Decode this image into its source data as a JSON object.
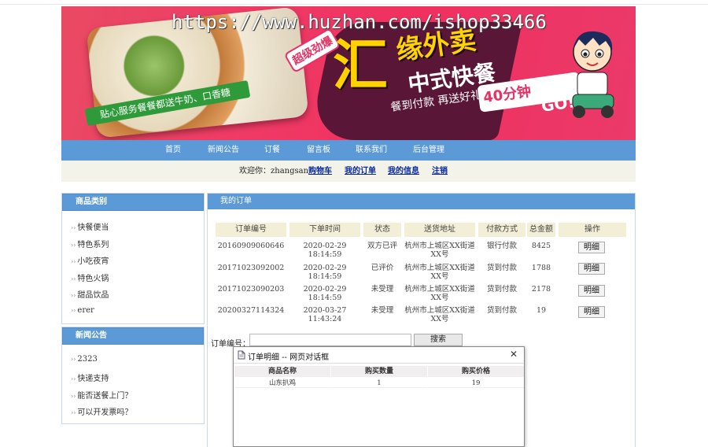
{
  "banner": {
    "watermark": "https://www.huzhan.com/ishop33466",
    "headline_big": "汇",
    "headline_top": "缘外卖",
    "headline_mid": "中式快餐",
    "slogan": "餐到付款 再送好礼",
    "badge": "超级劲爆",
    "ribbon": "贴心服务餐餐都送牛奶、口香糖",
    "promo": "40分钟",
    "go": "GO!",
    "colors": {
      "bg": "#ef3a66",
      "yellow": "#ffd200"
    }
  },
  "nav": {
    "items": [
      "首页",
      "新闻公告",
      "订餐",
      "留言板",
      "联系我们",
      "后台管理"
    ]
  },
  "welcome": {
    "greeting": "欢迎你：zhangsan",
    "links": [
      "购物车",
      "我的订单",
      "我的信息",
      "注销"
    ]
  },
  "sidebar": {
    "categories_title": "商品类别",
    "categories": [
      "快餐便当",
      "特色系列",
      "小吃夜宵",
      "特色火锅",
      "甜品饮品",
      "erer"
    ],
    "news_title": "新闻公告",
    "news": [
      "2323",
      "快递支持",
      "能否送餐上门？",
      "可以开发票吗？"
    ]
  },
  "orders": {
    "title": "我的订单",
    "columns": [
      "订单编号",
      "下单时间",
      "状态",
      "送货地址",
      "付款方式",
      "总金额",
      "操作"
    ],
    "rows": [
      {
        "id": "20160909060646",
        "time": "2020-02-29 18:14:59",
        "status": "双方已评",
        "address": "杭州市上城区XX街道XX号",
        "payment": "银行付款",
        "total": "8425",
        "action": "明细"
      },
      {
        "id": "20171023092002",
        "time": "2020-02-29 18:14:59",
        "status": "已评价",
        "address": "杭州市上城区XX街道XX号",
        "payment": "货到付款",
        "total": "1788",
        "action": "明细"
      },
      {
        "id": "20171023090203",
        "time": "2020-02-29 18:14:59",
        "status": "未受理",
        "address": "杭州市上城区XX街道XX号",
        "payment": "货到付款",
        "total": "2178",
        "action": "明细"
      },
      {
        "id": "20200327114324",
        "time": "2020-03-27 11:43:24",
        "status": "未受理",
        "address": "杭州市上城区XX街道XX号",
        "payment": "货到付款",
        "total": "19",
        "action": "明细"
      }
    ]
  },
  "search": {
    "label": "订单编号：",
    "value": "",
    "button": "搜索"
  },
  "dialog": {
    "title": "订单明细 -- 网页对话框",
    "close": "✕",
    "columns": [
      "商品名称",
      "购买数量",
      "购买价格"
    ],
    "rows": [
      {
        "name": "山东扒鸡",
        "qty": "1",
        "price": "19"
      }
    ]
  }
}
